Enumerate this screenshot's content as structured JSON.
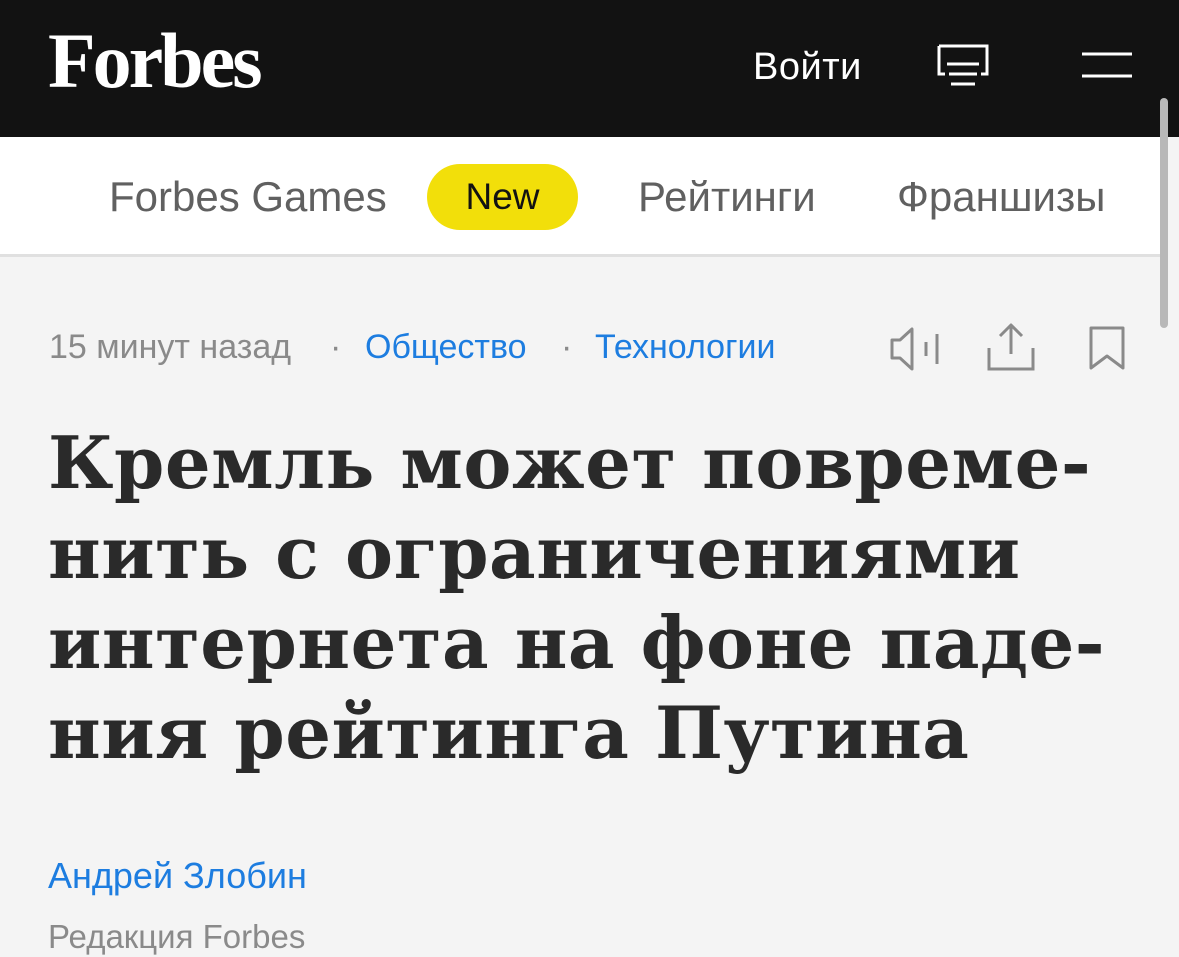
{
  "header": {
    "logo": "Forbes",
    "login_label": "Войти",
    "reader_icon": "reader-mode-icon",
    "menu_icon": "hamburger-menu-icon"
  },
  "nav": {
    "games": "Forbes Games",
    "badge": "New",
    "ratings": "Рейтинги",
    "franchises": "Франшизы",
    "badge_color": "#f2df0a"
  },
  "meta": {
    "time": "15 минут назад",
    "separator": "·",
    "tags": [
      "Общество",
      "Технологии"
    ],
    "icons": [
      "audio-icon",
      "share-icon",
      "bookmark-icon"
    ],
    "link_color": "#1d7de0"
  },
  "article": {
    "headline_lines": [
      "Кремль может повреме-",
      "нить с ограничениями",
      "интернета на фоне паде-",
      "ния рейтинга Путина"
    ],
    "author": "Андрей Злобин",
    "author_role": "Редакция Forbes"
  }
}
